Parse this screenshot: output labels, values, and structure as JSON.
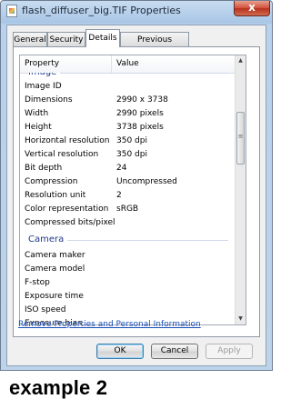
{
  "window": {
    "title": "flash_diffuser_big.TIF Properties",
    "close_glyph": "x"
  },
  "tabs": [
    {
      "label": "General",
      "active": false
    },
    {
      "label": "Security",
      "active": false
    },
    {
      "label": "Details",
      "active": true
    },
    {
      "label": "Previous Versions",
      "active": false
    }
  ],
  "details": {
    "column_property": "Property",
    "column_value": "Value",
    "partial_group": "Image",
    "image_rows": [
      {
        "property": "Image ID",
        "value": ""
      },
      {
        "property": "Dimensions",
        "value": "2990 x 3738"
      },
      {
        "property": "Width",
        "value": "2990 pixels"
      },
      {
        "property": "Height",
        "value": "3738 pixels"
      },
      {
        "property": "Horizontal resolution",
        "value": "350 dpi"
      },
      {
        "property": "Vertical resolution",
        "value": "350 dpi"
      },
      {
        "property": "Bit depth",
        "value": "24"
      },
      {
        "property": "Compression",
        "value": "Uncompressed"
      },
      {
        "property": "Resolution unit",
        "value": "2"
      },
      {
        "property": "Color representation",
        "value": "sRGB"
      },
      {
        "property": "Compressed bits/pixel",
        "value": ""
      }
    ],
    "camera_group": "Camera",
    "camera_rows": [
      {
        "property": "Camera maker",
        "value": ""
      },
      {
        "property": "Camera model",
        "value": ""
      },
      {
        "property": "F-stop",
        "value": ""
      },
      {
        "property": "Exposure time",
        "value": ""
      },
      {
        "property": "ISO speed",
        "value": ""
      },
      {
        "property": "Exposure bias",
        "value": ""
      }
    ]
  },
  "remove_link": "Remove Properties and Personal Information",
  "buttons": {
    "ok": "OK",
    "cancel": "Cancel",
    "apply": "Apply"
  },
  "caption": "example 2",
  "icons": {
    "scroll_up": "up-arrow-icon",
    "scroll_down": "down-arrow-icon"
  }
}
